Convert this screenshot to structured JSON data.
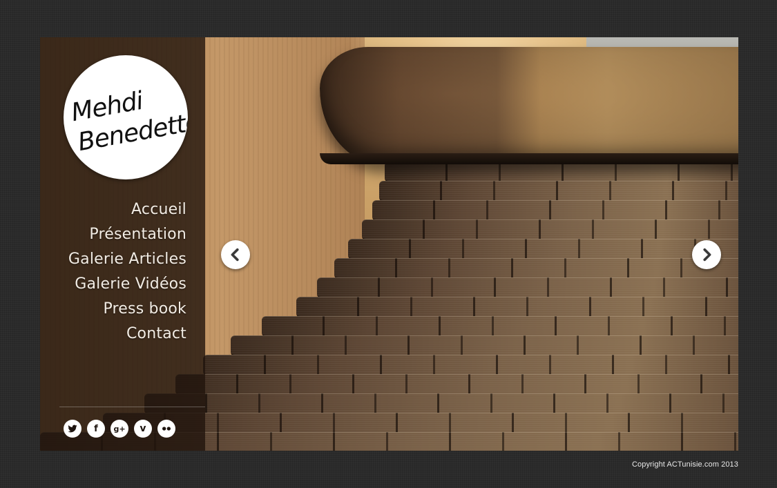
{
  "logo": {
    "line1": "Mehdi",
    "line2": "Benedetto"
  },
  "nav": {
    "items": [
      {
        "label": "Accueil"
      },
      {
        "label": "Présentation"
      },
      {
        "label": "Galerie Articles"
      },
      {
        "label": "Galerie Vidéos"
      },
      {
        "label": "Press book"
      },
      {
        "label": "Contact"
      }
    ]
  },
  "social": {
    "items": [
      {
        "icon": "twitter-icon"
      },
      {
        "icon": "facebook-icon",
        "glyph": "f"
      },
      {
        "icon": "google-plus-icon",
        "glyph": "g+"
      },
      {
        "icon": "vimeo-icon",
        "glyph": "v"
      },
      {
        "icon": "flickr-icon"
      }
    ]
  },
  "slider": {
    "prev_icon": "chevron-left-icon",
    "next_icon": "chevron-right-icon"
  },
  "footer": {
    "copyright": "Copyright ACTunisie.com 2013"
  },
  "colors": {
    "page_background": "#2b2b2b",
    "sidebar_overlay": "#20140d",
    "nav_text": "#f2ece4",
    "icon_circle": "#ffffff"
  }
}
